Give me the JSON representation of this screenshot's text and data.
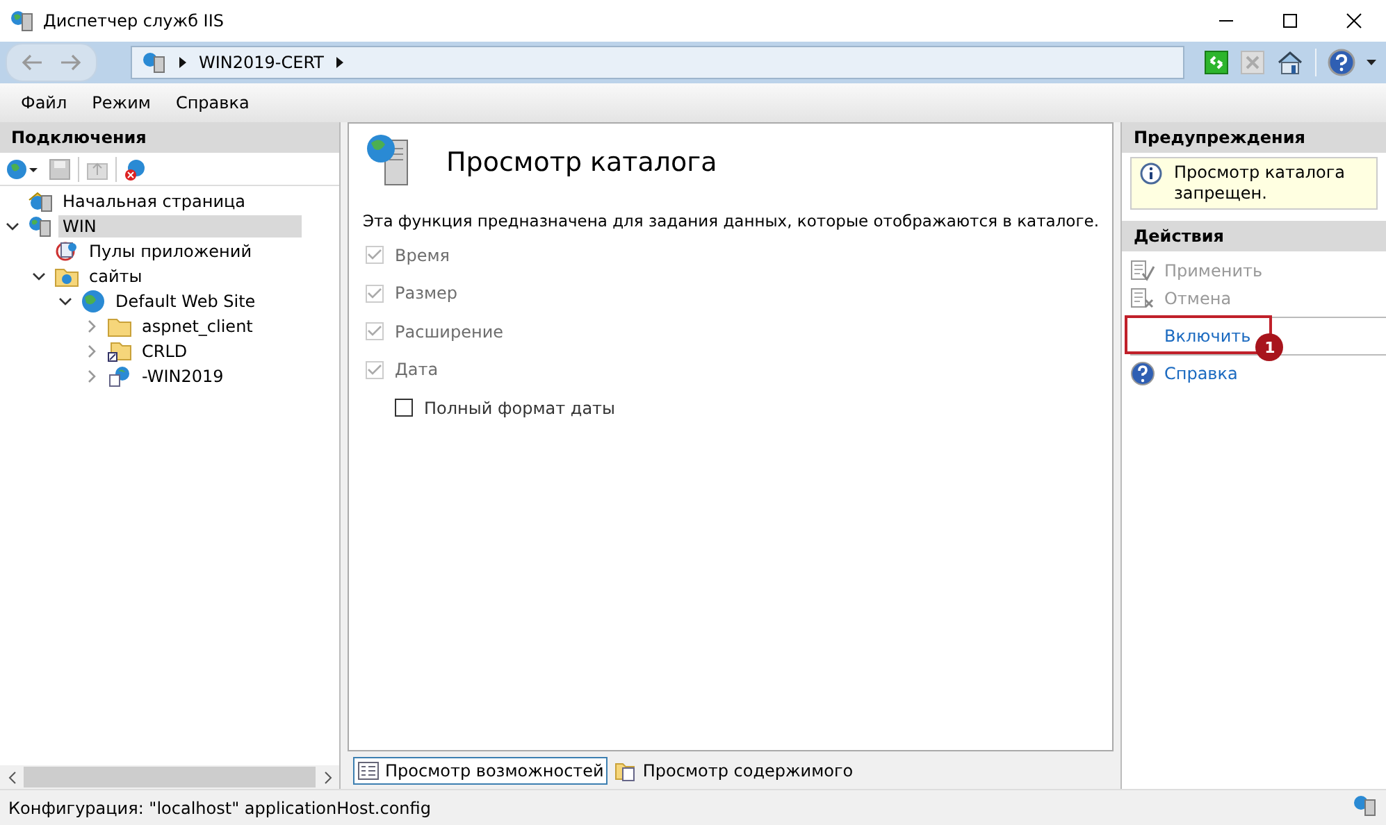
{
  "window": {
    "title": "Диспетчер служб IIS"
  },
  "address_bar": {
    "path": [
      "WIN2019-CERT"
    ]
  },
  "menu": [
    "Файл",
    "Режим",
    "Справка"
  ],
  "connections": {
    "title": "Подключения",
    "tree": [
      {
        "label": "Начальная страница",
        "kind": "home",
        "selected": false
      },
      {
        "label": "WIN",
        "kind": "server",
        "selected": true,
        "expanded": true,
        "children": [
          {
            "label": "Пулы приложений",
            "kind": "pool",
            "selected": false
          },
          {
            "label": "сайты",
            "kind": "sites",
            "selected": false,
            "expanded": true,
            "children": [
              {
                "label": "Default Web Site",
                "kind": "globe",
                "selected": false,
                "expanded": true,
                "children": [
                  {
                    "label": "aspnet_client",
                    "kind": "folder",
                    "selected": false,
                    "expanded": false
                  },
                  {
                    "label": "CRLD",
                    "kind": "vfolder",
                    "selected": false,
                    "expanded": false
                  },
                  {
                    "label": "-WIN2019",
                    "kind": "app",
                    "selected": false,
                    "expanded": false
                  }
                ]
              }
            ]
          }
        ]
      }
    ]
  },
  "feature": {
    "title": "Просмотр каталога",
    "description": "Эта функция предназначена для задания данных, которые отображаются в каталоге.",
    "options": [
      {
        "label": "Время",
        "checked": true,
        "disabled": true
      },
      {
        "label": "Размер",
        "checked": true,
        "disabled": true
      },
      {
        "label": "Расширение",
        "checked": true,
        "disabled": true
      },
      {
        "label": "Дата",
        "checked": true,
        "disabled": true,
        "children": [
          {
            "label": "Полный формат даты",
            "checked": false,
            "disabled": false
          }
        ]
      }
    ]
  },
  "view_tabs": [
    {
      "label": "Просмотр возможностей",
      "selected": true
    },
    {
      "label": "Просмотр содержимого",
      "selected": false
    }
  ],
  "alerts": {
    "title": "Предупреждения",
    "message": "Просмотр каталога запрещен."
  },
  "actions": {
    "title": "Действия",
    "items": [
      {
        "label": "Применить",
        "kind": "apply",
        "disabled": true,
        "highlighted": false
      },
      {
        "label": "Отмена",
        "kind": "cancel",
        "disabled": true,
        "highlighted": false
      },
      {
        "label": "Включить",
        "kind": "plain",
        "disabled": false,
        "highlighted": true,
        "badge": "1"
      },
      {
        "label": "Справка",
        "kind": "help",
        "disabled": false,
        "highlighted": false
      }
    ]
  },
  "status_bar": {
    "text": "Конфигурация: \"localhost\" applicationHost.config"
  }
}
